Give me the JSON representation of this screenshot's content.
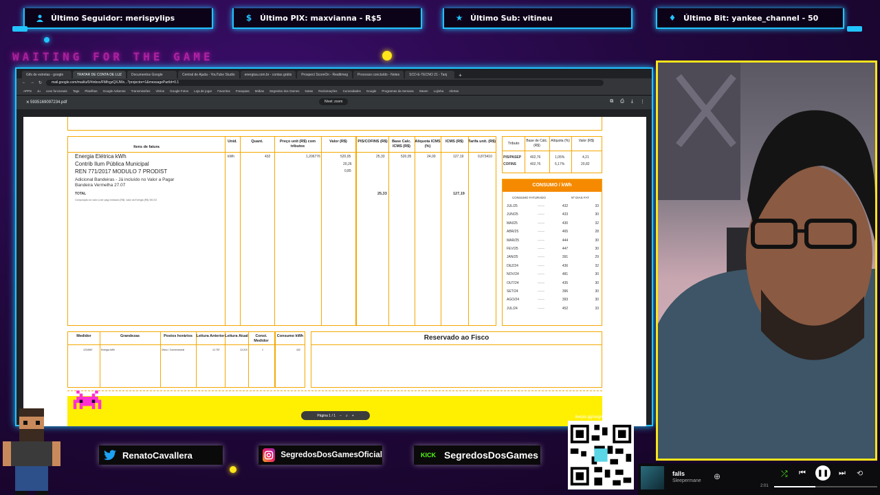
{
  "overlay": {
    "alerts": [
      {
        "label": "Último Seguidor: merispylips",
        "icon": "user-icon"
      },
      {
        "label": "Último PIX: maxvianna - R$5",
        "icon": "dollar-icon"
      },
      {
        "label": "Último Sub: vitineu",
        "icon": "star-icon"
      },
      {
        "label": "Último Bit: yankee_channel - 50",
        "icon": "diamond-icon"
      }
    ],
    "waiting_text": "WAITING FOR THE GAME",
    "socials": [
      {
        "label": "RenatoCavallera",
        "icon": "twitter-icon"
      },
      {
        "label": "SegredosDosGamesOficial",
        "icon": "instagram-icon"
      },
      {
        "label": "SegredosDosGames",
        "icon": "kick-icon",
        "icon_text": "KICK"
      }
    ],
    "qr_label": "livepix.gg/segredosdosgames",
    "accent": "#22c4ff",
    "webcam_border": "#ffe51a"
  },
  "browser": {
    "tabs": [
      "Gifs de estrelas - google",
      "TRATAR DE CONTA DE LUZ",
      "Documentos Google",
      "Central de Ajuda - YouTube Studio",
      "energisa.com.br - contas grátis",
      "Prospect ScoreOn - Realtimeg",
      "Processo concluído - Notes",
      "SCD-E-TECNO 21 - Tanj"
    ],
    "url": "mail.google.com/mail/u/0/#inbox/FMfcgzQXJWx...?projector=1&messagePartId=0.1",
    "bookmarks": [
      "APPS",
      "Ju",
      "cons funcionais",
      "Tags",
      "Planilhas",
      "Google Adsense",
      "Transmissões",
      "Vitrine",
      "Google Fotos",
      "Loja de jogar",
      "Favoritos",
      "Franquias",
      "Mídias",
      "Segredos dos Games",
      "Notas",
      "Reclamações",
      "Curiosidades",
      "Google",
      "Programas da Semana",
      "Steam",
      "Lojinha",
      "Alertas"
    ],
    "pdf": {
      "filename": "5935169097234.pdf",
      "zoom": "Nível: zoom",
      "pager": "Página 1 / 1"
    }
  },
  "invoice": {
    "items_header": [
      "Itens de fatura",
      "Unid.",
      "Quant.",
      "Preço unit (R$) com tributos",
      "Valor (R$)",
      "PIS/COFINS (R$)",
      "Base Calc. ICMS (R$)",
      "Alíquota ICMS (%)",
      "ICMS (R$)",
      "Tarifa unit. (R$)"
    ],
    "items": [
      {
        "desc": "Energia Elétrica kWh",
        "unid": "kWh",
        "quant": "432",
        "preco": "1,206776",
        "valor": "520,05",
        "pis": "25,33",
        "base": "520,05",
        "aliq": "24,00",
        "icms": "127,19",
        "tarifa": "0,873410"
      },
      {
        "desc": "Contrib Ilum Pública Municipal",
        "valor": "20,26"
      },
      {
        "desc": "REN 771/2017 MODULO 7 PRODIST",
        "valor": "0,85"
      }
    ],
    "notes": [
      "Adicional Bandeiras - Já incluído no Valor a Pagar",
      "Bandeira Vermelha 27.07"
    ],
    "total_label": "TOTAL",
    "total_pis": "25,33",
    "total_icms": "127,19",
    "footnote": "Composição do valor a ser pago indicado (R$): valor da Energia (R$) 392,92",
    "tributos_header": [
      "Tributo",
      "Base de Cálc. (R$)",
      "Alíquota (%)",
      "Valor (R$)"
    ],
    "tributos": [
      {
        "name": "PIS/PASEP",
        "base": "402,76",
        "aliq": "1,05%",
        "valor": "4,21"
      },
      {
        "name": "COFINS",
        "base": "402,76",
        "aliq": "5,17%",
        "valor": "20,82"
      }
    ],
    "consumo_title": "CONSUMO / kWh",
    "consumo_headers": [
      "CONSUMO FATURADO",
      "Nº DIAS FAT"
    ],
    "consumo_rows": [
      {
        "mes": "JUL/25",
        "kwh": "432",
        "dias": "33"
      },
      {
        "mes": "JUN/25",
        "kwh": "433",
        "dias": "30"
      },
      {
        "mes": "MAI/25",
        "kwh": "430",
        "dias": "32"
      },
      {
        "mes": "ABR/25",
        "kwh": "465",
        "dias": "28"
      },
      {
        "mes": "MAR/25",
        "kwh": "444",
        "dias": "30"
      },
      {
        "mes": "FEV/25",
        "kwh": "447",
        "dias": "30"
      },
      {
        "mes": "JAN/25",
        "kwh": "391",
        "dias": "29"
      },
      {
        "mes": "DEZ/24",
        "kwh": "436",
        "dias": "32"
      },
      {
        "mes": "NOV/24",
        "kwh": "481",
        "dias": "30"
      },
      {
        "mes": "OUT/24",
        "kwh": "435",
        "dias": "30"
      },
      {
        "mes": "SET/24",
        "kwh": "396",
        "dias": "30"
      },
      {
        "mes": "AGO/24",
        "kwh": "393",
        "dias": "30"
      },
      {
        "mes": "JUL/24",
        "kwh": "452",
        "dias": "33"
      }
    ],
    "medidor_header": [
      "Medidor",
      "Grandezas",
      "Postos horários",
      "Leitura Anterior",
      "Leitura Atual",
      "Const. Medidor",
      "Consumo kWh"
    ],
    "medidor_row": {
      "medidor": "1234567",
      "grandeza": "Energia kWh",
      "posto": "Único / Convencional",
      "anterior": "12.787",
      "atual": "13.219",
      "const": "1",
      "consumo": "432"
    },
    "fisco_title": "Reservado ao Fisco",
    "invoice_accent": "#f5a700",
    "consumo_accent": "#f58a00"
  },
  "player": {
    "track": "falls",
    "artist": "Sleepermane",
    "time": "2:01"
  }
}
